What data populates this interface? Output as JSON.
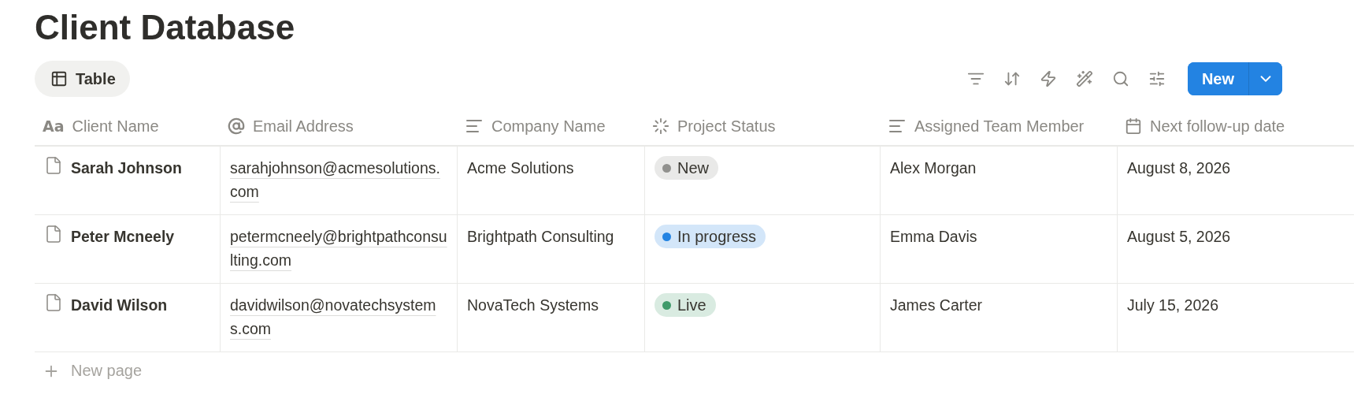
{
  "title": "Client Database",
  "view_tab": {
    "label": "Table",
    "selected": true
  },
  "new_button": {
    "label": "New"
  },
  "table": {
    "columns": [
      {
        "label": "Client Name",
        "kind": "title",
        "glyph": "Aa"
      },
      {
        "label": "Email Address",
        "kind": "email"
      },
      {
        "label": "Company Name",
        "kind": "text"
      },
      {
        "label": "Project Status",
        "kind": "status"
      },
      {
        "label": "Assigned Team Member",
        "kind": "text"
      },
      {
        "label": "Next follow-up date",
        "kind": "date"
      }
    ],
    "rows": [
      {
        "client": "Sarah Johnson",
        "email": "sarahjohnson@acmesolutions.com",
        "company": "Acme Solutions",
        "status": {
          "label": "New",
          "color": "#91918e"
        },
        "member": "Alex Morgan",
        "date": "August 8, 2026"
      },
      {
        "client": "Peter Mcneely",
        "email": "petermcneely@brightpathconsulting.com",
        "company": "Brightpath Consulting",
        "status": {
          "label": "In progress",
          "color": "#2383e2"
        },
        "member": "Emma Davis",
        "date": "August 5, 2026"
      },
      {
        "client": "David Wilson",
        "email": "davidwilson@novatechsystems.com",
        "company": "NovaTech Systems",
        "status": {
          "label": "Live",
          "color": "#3f9a6a"
        },
        "member": "James Carter",
        "date": "July 15, 2026"
      }
    ]
  },
  "new_page": {
    "label": "New page"
  }
}
